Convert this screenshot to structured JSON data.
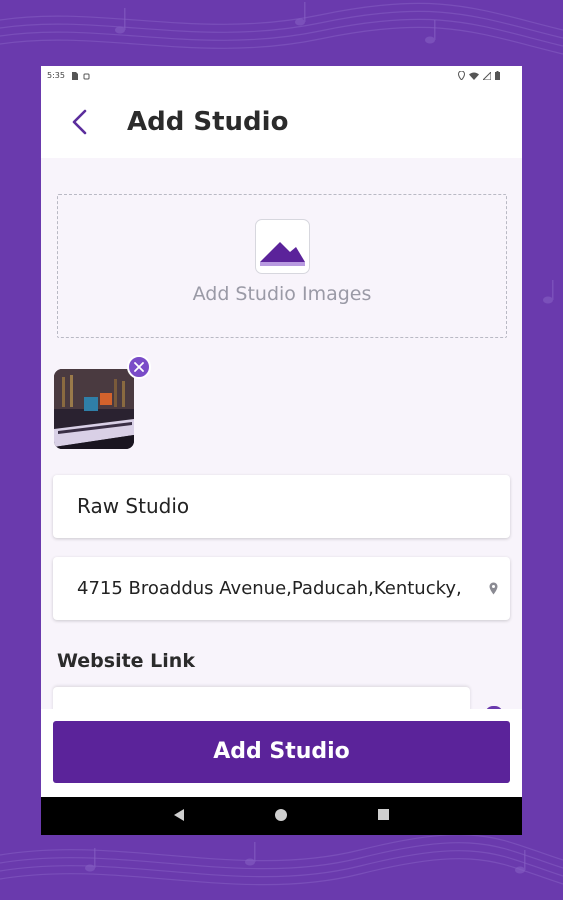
{
  "colors": {
    "background": "#6a3aad",
    "accent": "#5b239a",
    "icon_purple": "#6a3aad",
    "remove_badge": "#7a4cc8"
  },
  "status_bar": {
    "time": "5:35",
    "left_icons": [
      "sim-card-icon",
      "android-bug-icon"
    ],
    "right_icons": [
      "location-icon",
      "wifi-icon",
      "signal-icon",
      "battery-icon"
    ]
  },
  "header": {
    "back_icon": "chevron-left-icon",
    "title": "Add Studio"
  },
  "upload": {
    "icon": "image-placeholder-icon",
    "label": "Add Studio Images"
  },
  "thumbnails": [
    {
      "icon": "studio-photo",
      "remove_icon": "close-icon"
    }
  ],
  "form": {
    "studio_name": {
      "value": "Raw Studio"
    },
    "address": {
      "value": "4715 Broaddus Avenue,Paducah,Kentucky,",
      "icon": "map-pin-icon"
    },
    "website": {
      "label": "Website Link",
      "value": ""
    }
  },
  "submit_button": {
    "label": "Add Studio"
  },
  "nav_bar": {
    "buttons": [
      "back-triangle-icon",
      "home-circle-icon",
      "recents-square-icon"
    ]
  }
}
